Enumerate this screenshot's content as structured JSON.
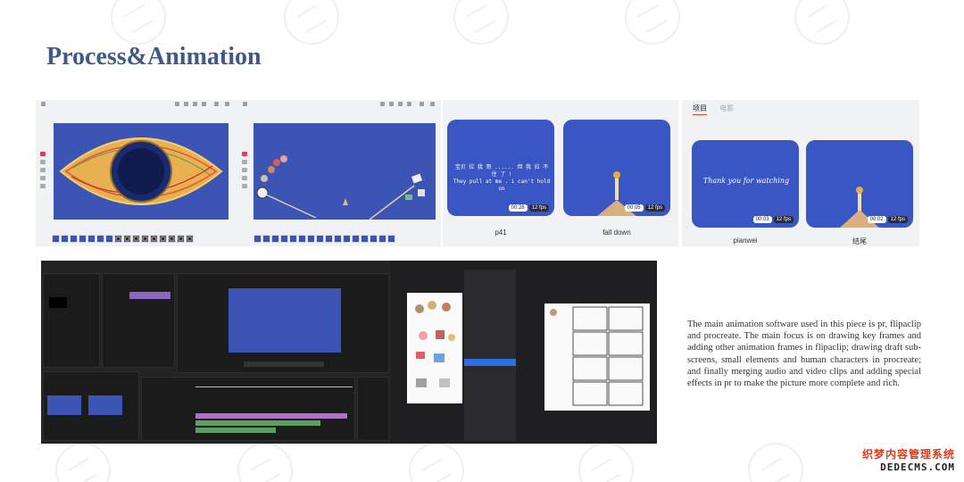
{
  "title": "Process&Animation",
  "cards": [
    {
      "label": "p41",
      "duration": "00:28",
      "fps": "12 fps",
      "text": "宝贝 拉 我 哥 ...... 但 我 拉 不 住 了 !\nThey pull at me . i can't hold on"
    },
    {
      "label": "fall down",
      "duration": "00:05",
      "fps": "12 fps"
    },
    {
      "label": "pianwei",
      "duration": "00:03",
      "fps": "12 fps",
      "text": "Thank you for watching"
    },
    {
      "label": "结尾",
      "duration": "00:02",
      "fps": "12 fps"
    }
  ],
  "tabs": [
    "项目",
    "电影"
  ],
  "description": "The main animation software used in this piece is pr, flipaclip and procreate. The main focus is on drawing key frames and adding other animation frames in flipaclip; drawing draft sub- screens, small elements and human characters in procreate; and finally merging audio and video clips and adding special effects in pr to make the picture more complete and rich.",
  "logo": {
    "line1": "织梦内容管理系统",
    "line2": "DEDECMS.COM"
  },
  "colors": {
    "title": "#3d5a8a",
    "canvas": "#3c55b5",
    "card": "#3a55c4"
  }
}
